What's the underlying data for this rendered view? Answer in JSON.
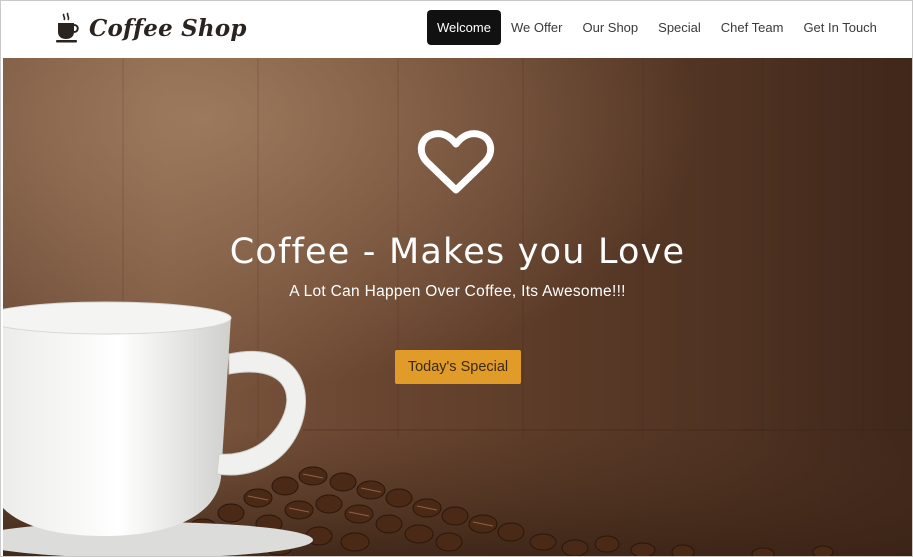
{
  "brand": {
    "name": "Coffee Shop",
    "icon": "coffee-cup-icon"
  },
  "nav": {
    "items": [
      {
        "label": "Welcome",
        "active": true
      },
      {
        "label": "We Offer",
        "active": false
      },
      {
        "label": "Our Shop",
        "active": false
      },
      {
        "label": "Special",
        "active": false
      },
      {
        "label": "Chef Team",
        "active": false
      },
      {
        "label": "Get In Touch",
        "active": false
      }
    ]
  },
  "hero": {
    "icon": "heart-icon",
    "title": "Coffee - Makes you Love",
    "subtitle": "A Lot Can Happen Over Coffee, Its Awesome!!!",
    "button_label": "Today's Special"
  },
  "colors": {
    "accent_button": "#e09b28",
    "nav_active_bg": "#111111",
    "hero_bg": "#5a3a27",
    "text_dark": "#2a2420"
  }
}
